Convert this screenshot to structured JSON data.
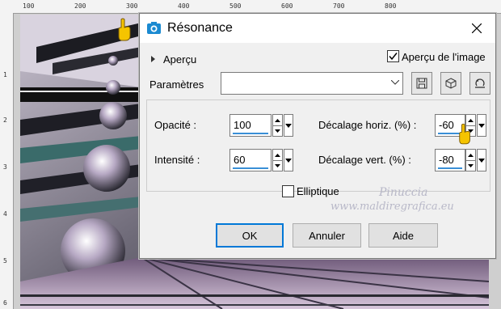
{
  "dialog": {
    "title": "Résonance",
    "preview_label": "Aperçu",
    "image_preview_label": "Aperçu de l'image",
    "image_preview_checked": true,
    "params_label": "Paramètres",
    "params_value": ""
  },
  "fields": {
    "opacity": {
      "label": "Opacité :",
      "value": "100"
    },
    "intensity": {
      "label": "Intensité :",
      "value": "60"
    },
    "offset_h": {
      "label": "Décalage horiz. (%) :",
      "value": "-60"
    },
    "offset_v": {
      "label": "Décalage vert. (%) :",
      "value": "-80"
    }
  },
  "elliptic": {
    "label": "Elliptique",
    "checked": false
  },
  "buttons": {
    "ok": "OK",
    "cancel": "Annuler",
    "help": "Aide"
  },
  "watermark": {
    "line1": "Pinuccia",
    "line2": "www.maldiregrafica.eu"
  },
  "ruler": {
    "top": [
      "100",
      "200",
      "300",
      "400",
      "500",
      "600",
      "700",
      "800"
    ],
    "left": [
      "1",
      "2",
      "3",
      "4",
      "5",
      "6"
    ]
  },
  "icons": {
    "app": "camera-icon",
    "close": "close-icon",
    "save": "save-icon",
    "random": "dice-icon",
    "reset": "reset-icon",
    "pointer": "hand-pointer-icon"
  }
}
